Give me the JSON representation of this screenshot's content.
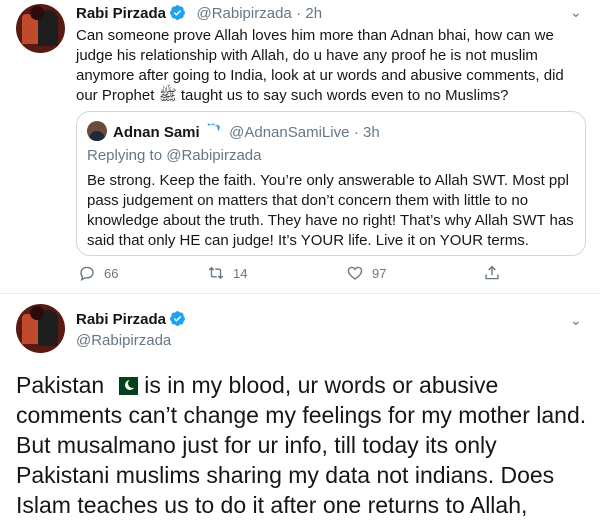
{
  "tweet1": {
    "author_name": "Rabi Pirzada",
    "author_handle": "@Rabipirzada",
    "time": "· 2h",
    "text": "Can someone prove Allah loves him more than Adnan bhai, how can we judge his relationship with Allah, do u have any proof he is not muslim anymore after going to India, look at ur words and abusive comments, did our Prophet ﷺ taught us to say such words even to no Muslims?",
    "quote": {
      "author_name": "Adnan Sami",
      "author_handle": "@AdnanSamiLive",
      "time": "· 3h",
      "replying_label": "Replying to",
      "replying_handle": "@Rabipirzada",
      "text": "Be strong. Keep the faith. You’re only answerable to Allah SWT. Most ppl pass judgement on matters that don’t concern them with little to no knowledge about the truth. They have no right! That’s why Allah SWT has said that only HE can judge! It’s YOUR life. Live it on YOUR terms."
    },
    "actions": {
      "replies": "66",
      "retweets": "14",
      "likes": "97"
    }
  },
  "tweet2": {
    "author_name": "Rabi Pirzada",
    "author_handle": "@Rabipirzada",
    "text_before_flag": "Pakistan",
    "text_after_flag": "is in my blood, ur words or abusive comments can’t change my feelings for my mother land. But musalmano just for ur info, till today its only Pakistani muslims sharing my data not indians. Does Islam teaches us to do it after one returns to Allah,"
  },
  "colors": {
    "verified_blue": "#1da1f2",
    "muted_text": "#657786",
    "border": "#ccd6dd"
  }
}
